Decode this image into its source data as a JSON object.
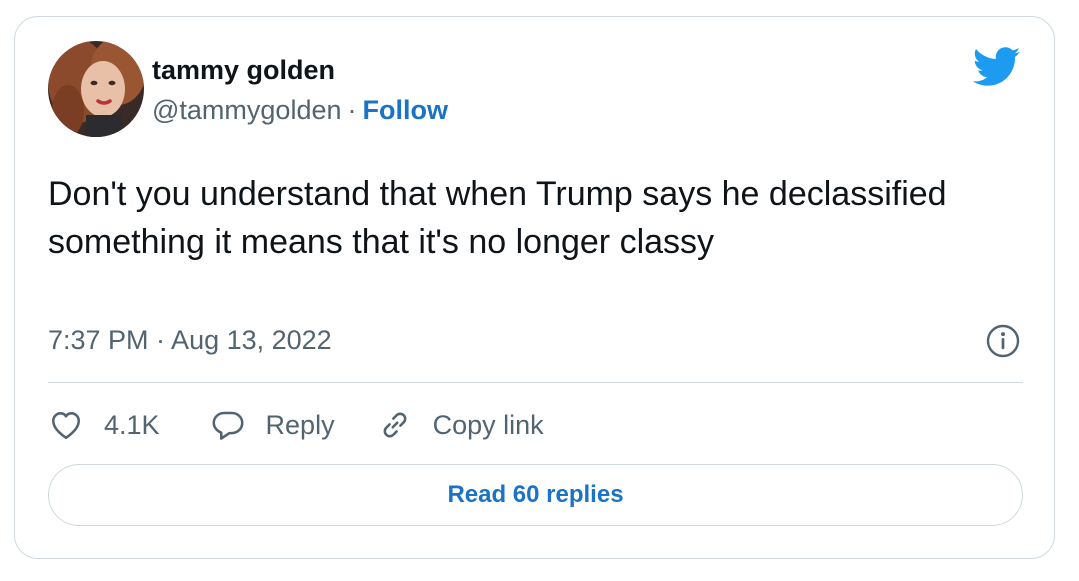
{
  "author": {
    "display_name": "tammy golden",
    "handle": "@tammygolden",
    "separator": "·",
    "follow_label": "Follow"
  },
  "tweet": {
    "text": "Don't you understand that when Trump says he declassified something it means that it's no longer classy",
    "timestamp": "7:37 PM · Aug 13, 2022"
  },
  "actions": {
    "like_count": "4.1K",
    "reply_label": "Reply",
    "copy_link_label": "Copy link"
  },
  "replies_button_label": "Read 60 replies",
  "icons": {
    "brand": "twitter-bird-icon",
    "info": "info-icon",
    "like": "heart-icon",
    "reply": "speech-bubble-icon",
    "copy_link": "link-icon"
  },
  "colors": {
    "brand_blue": "#1d9bf0",
    "link_blue": "#1a73c7",
    "text_primary": "#0f1419",
    "text_secondary": "#536471",
    "border": "#cfd9de"
  }
}
